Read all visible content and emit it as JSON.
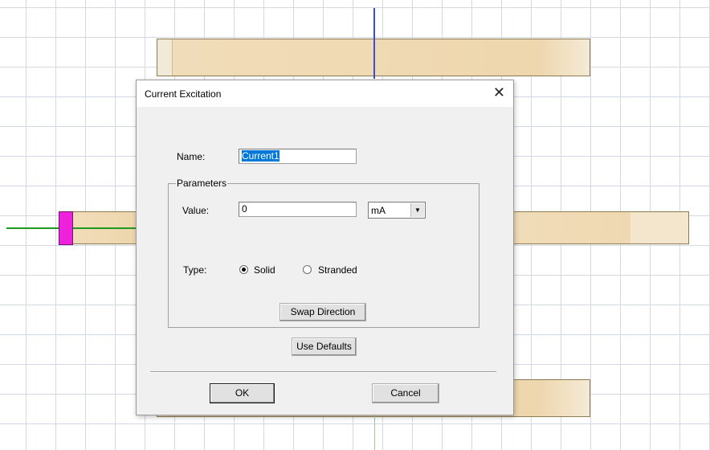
{
  "dialog": {
    "title": "Current Excitation",
    "name_label": "Name:",
    "name_value": "Current1",
    "group_label": "Parameters",
    "value_label": "Value:",
    "value_value": "0",
    "unit_selected": "mA",
    "type_label": "Type:",
    "type_options": [
      "Solid",
      "Stranded"
    ],
    "type_selected": "Solid",
    "swap_label": "Swap Direction",
    "defaults_label": "Use Defaults",
    "ok_label": "OK",
    "cancel_label": "Cancel"
  },
  "icons": {
    "close": "close-icon",
    "dropdown": "chevron-down-icon"
  },
  "colors": {
    "coil_fill": "#efd9b2",
    "terminal": "#ee22dd",
    "axis_blue": "#3a4dd8",
    "axis_green": "#1e9a1e",
    "selection": "#0078d7"
  }
}
